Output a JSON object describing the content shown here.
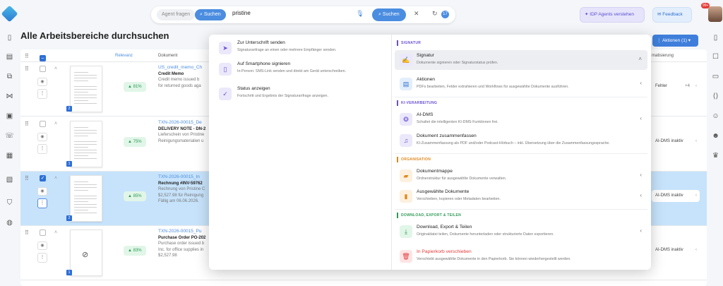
{
  "topbar": {
    "agent_tab": "Agent fragen",
    "search_tab": "Suchen",
    "query": "pristine",
    "search_button": "Suchen",
    "clear_icon": "close-icon",
    "history_count": "17",
    "idp_button": "IDP Agents verstehen",
    "feedback_button": "Feedback",
    "avatar_badge": "99+"
  },
  "page": {
    "title": "Alle Arbeitsbereiche durchsuchen",
    "actions_button": "Aktionen (1)"
  },
  "table": {
    "headers": {
      "relevance": "Relevanz",
      "document": "Dokument",
      "category": "matisierung"
    },
    "rows": [
      {
        "title": "US_credit_memo_Ch",
        "name": "Credit Memo",
        "desc1": "Credit memo issued b",
        "desc2": "for returned goods aga",
        "desc3": "",
        "relevance": "81%",
        "pages": "2",
        "selected": false,
        "tag": "Fehler",
        "tag_extra": "+4"
      },
      {
        "title": "TXN-2026-00015_De",
        "name": "DELIVERY NOTE - DN-2",
        "desc1": "Lieferschein von Pristine",
        "desc2": "Reinigungsmaterialien u",
        "desc3": "",
        "relevance": "75%",
        "pages": "1",
        "selected": false,
        "tag": "AI-DMS inaktiv",
        "tag_extra": ""
      },
      {
        "title": "TXN-2026-00015_In",
        "name": "Rechnung #INV-59762",
        "desc1": "Rechnung von Pristine C",
        "desc2": "$2,527.98 für Reinigung",
        "desc3": "Fällig am 06.06.2026.",
        "relevance": "85%",
        "pages": "2",
        "selected": true,
        "tag": "AI-DMS inaktiv",
        "tag_extra": ""
      },
      {
        "title": "TXN-2026-00015_Pu",
        "name": "Purchase Order PO-202",
        "desc1": "Purchase order issued b",
        "desc2": "Inc. for office supplies in",
        "desc3": "$2,527.98",
        "relevance": "83%",
        "pages": "1",
        "selected": false,
        "tag": "AI-DMS inaktiv",
        "tag_extra": ""
      }
    ]
  },
  "popup": {
    "left_items": [
      {
        "title": "Zur Unterschrift senden",
        "sub": "Signaturanfrage an einen oder mehrere Empfänger senden.",
        "icon": "send-icon"
      },
      {
        "title": "Auf Smartphone signieren",
        "sub": "In-Person: SMS-Link senden und direkt am Gerät unterschreiben.",
        "icon": "smartphone-icon"
      },
      {
        "title": "Status anzeigen",
        "sub": "Fortschritt und Ergebnis der Signaturanfrage anzeigen.",
        "icon": "clipboard-check-icon"
      }
    ],
    "sections": {
      "signatur": "SIGNATUR",
      "ki": "KI-VERARBEITUNG",
      "organisation": "ORGANISATION",
      "download": "DOWNLOAD, EXPORT & TEILEN"
    },
    "right_items": {
      "signatur": {
        "title": "Signatur",
        "sub": "Dokumente signieren oder Signaturstatus prüfen."
      },
      "aktionen": {
        "title": "Aktionen",
        "sub": "PDFs bearbeiten, Felder extrahieren und Workflows für ausgewählte Dokumente ausführen."
      },
      "aidms": {
        "title": "AI-DMS",
        "sub": "Schaltet die intelligenten KI-DMS-Funktionen frei."
      },
      "zusammenfassen": {
        "title": "Dokument zusammenfassen",
        "sub": "KI-Zusammenfassung als PDF und/oder Podcast-Hörbuch – inkl. Übersetzung über die Zusammenfassungssprache."
      },
      "dokumentmappe": {
        "title": "Dokumentmappe",
        "sub": "Ordnerstruktur für ausgewählte Dokumente verwalten."
      },
      "ausgewaehlte": {
        "title": "Ausgewählte Dokumente",
        "sub": "Verschieben, kopieren oder Metadaten bearbeiten."
      },
      "download": {
        "title": "Download, Export & Teilen",
        "sub": "Originaldatei teilen, Dokumente herunterladen oder strukturierte Daten exportieren."
      },
      "papierkorb": {
        "title": "In Papierkorb verschieben",
        "sub": "Verschiebt ausgewählte Dokumente in den Papierkorb. Sie können wiederhergestellt werden."
      }
    }
  },
  "colors": {
    "accent": "#4b8de0",
    "selected_row": "#c7e3fb",
    "danger": "#e23b3b",
    "purple": "#6a4fd2",
    "orange": "#e0871c",
    "green": "#2e9a56"
  }
}
